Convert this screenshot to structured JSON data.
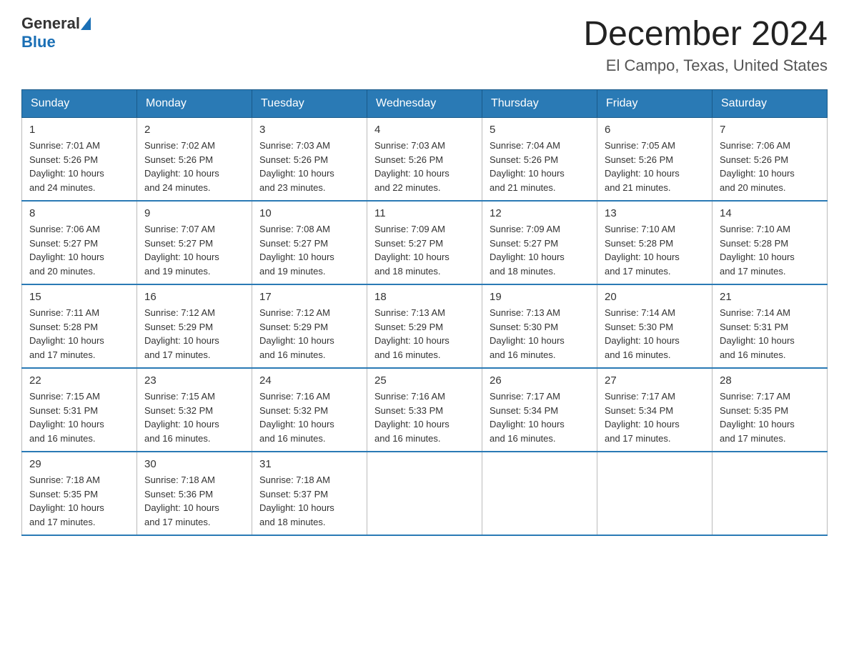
{
  "header": {
    "logo": {
      "general": "General",
      "blue": "Blue"
    },
    "title": "December 2024",
    "location": "El Campo, Texas, United States"
  },
  "weekdays": [
    "Sunday",
    "Monday",
    "Tuesday",
    "Wednesday",
    "Thursday",
    "Friday",
    "Saturday"
  ],
  "weeks": [
    [
      {
        "day": "1",
        "sunrise": "7:01 AM",
        "sunset": "5:26 PM",
        "daylight": "10 hours and 24 minutes."
      },
      {
        "day": "2",
        "sunrise": "7:02 AM",
        "sunset": "5:26 PM",
        "daylight": "10 hours and 24 minutes."
      },
      {
        "day": "3",
        "sunrise": "7:03 AM",
        "sunset": "5:26 PM",
        "daylight": "10 hours and 23 minutes."
      },
      {
        "day": "4",
        "sunrise": "7:03 AM",
        "sunset": "5:26 PM",
        "daylight": "10 hours and 22 minutes."
      },
      {
        "day": "5",
        "sunrise": "7:04 AM",
        "sunset": "5:26 PM",
        "daylight": "10 hours and 21 minutes."
      },
      {
        "day": "6",
        "sunrise": "7:05 AM",
        "sunset": "5:26 PM",
        "daylight": "10 hours and 21 minutes."
      },
      {
        "day": "7",
        "sunrise": "7:06 AM",
        "sunset": "5:26 PM",
        "daylight": "10 hours and 20 minutes."
      }
    ],
    [
      {
        "day": "8",
        "sunrise": "7:06 AM",
        "sunset": "5:27 PM",
        "daylight": "10 hours and 20 minutes."
      },
      {
        "day": "9",
        "sunrise": "7:07 AM",
        "sunset": "5:27 PM",
        "daylight": "10 hours and 19 minutes."
      },
      {
        "day": "10",
        "sunrise": "7:08 AM",
        "sunset": "5:27 PM",
        "daylight": "10 hours and 19 minutes."
      },
      {
        "day": "11",
        "sunrise": "7:09 AM",
        "sunset": "5:27 PM",
        "daylight": "10 hours and 18 minutes."
      },
      {
        "day": "12",
        "sunrise": "7:09 AM",
        "sunset": "5:27 PM",
        "daylight": "10 hours and 18 minutes."
      },
      {
        "day": "13",
        "sunrise": "7:10 AM",
        "sunset": "5:28 PM",
        "daylight": "10 hours and 17 minutes."
      },
      {
        "day": "14",
        "sunrise": "7:10 AM",
        "sunset": "5:28 PM",
        "daylight": "10 hours and 17 minutes."
      }
    ],
    [
      {
        "day": "15",
        "sunrise": "7:11 AM",
        "sunset": "5:28 PM",
        "daylight": "10 hours and 17 minutes."
      },
      {
        "day": "16",
        "sunrise": "7:12 AM",
        "sunset": "5:29 PM",
        "daylight": "10 hours and 17 minutes."
      },
      {
        "day": "17",
        "sunrise": "7:12 AM",
        "sunset": "5:29 PM",
        "daylight": "10 hours and 16 minutes."
      },
      {
        "day": "18",
        "sunrise": "7:13 AM",
        "sunset": "5:29 PM",
        "daylight": "10 hours and 16 minutes."
      },
      {
        "day": "19",
        "sunrise": "7:13 AM",
        "sunset": "5:30 PM",
        "daylight": "10 hours and 16 minutes."
      },
      {
        "day": "20",
        "sunrise": "7:14 AM",
        "sunset": "5:30 PM",
        "daylight": "10 hours and 16 minutes."
      },
      {
        "day": "21",
        "sunrise": "7:14 AM",
        "sunset": "5:31 PM",
        "daylight": "10 hours and 16 minutes."
      }
    ],
    [
      {
        "day": "22",
        "sunrise": "7:15 AM",
        "sunset": "5:31 PM",
        "daylight": "10 hours and 16 minutes."
      },
      {
        "day": "23",
        "sunrise": "7:15 AM",
        "sunset": "5:32 PM",
        "daylight": "10 hours and 16 minutes."
      },
      {
        "day": "24",
        "sunrise": "7:16 AM",
        "sunset": "5:32 PM",
        "daylight": "10 hours and 16 minutes."
      },
      {
        "day": "25",
        "sunrise": "7:16 AM",
        "sunset": "5:33 PM",
        "daylight": "10 hours and 16 minutes."
      },
      {
        "day": "26",
        "sunrise": "7:17 AM",
        "sunset": "5:34 PM",
        "daylight": "10 hours and 16 minutes."
      },
      {
        "day": "27",
        "sunrise": "7:17 AM",
        "sunset": "5:34 PM",
        "daylight": "10 hours and 17 minutes."
      },
      {
        "day": "28",
        "sunrise": "7:17 AM",
        "sunset": "5:35 PM",
        "daylight": "10 hours and 17 minutes."
      }
    ],
    [
      {
        "day": "29",
        "sunrise": "7:18 AM",
        "sunset": "5:35 PM",
        "daylight": "10 hours and 17 minutes."
      },
      {
        "day": "30",
        "sunrise": "7:18 AM",
        "sunset": "5:36 PM",
        "daylight": "10 hours and 17 minutes."
      },
      {
        "day": "31",
        "sunrise": "7:18 AM",
        "sunset": "5:37 PM",
        "daylight": "10 hours and 18 minutes."
      },
      null,
      null,
      null,
      null
    ]
  ],
  "labels": {
    "sunrise": "Sunrise:",
    "sunset": "Sunset:",
    "daylight": "Daylight:"
  }
}
